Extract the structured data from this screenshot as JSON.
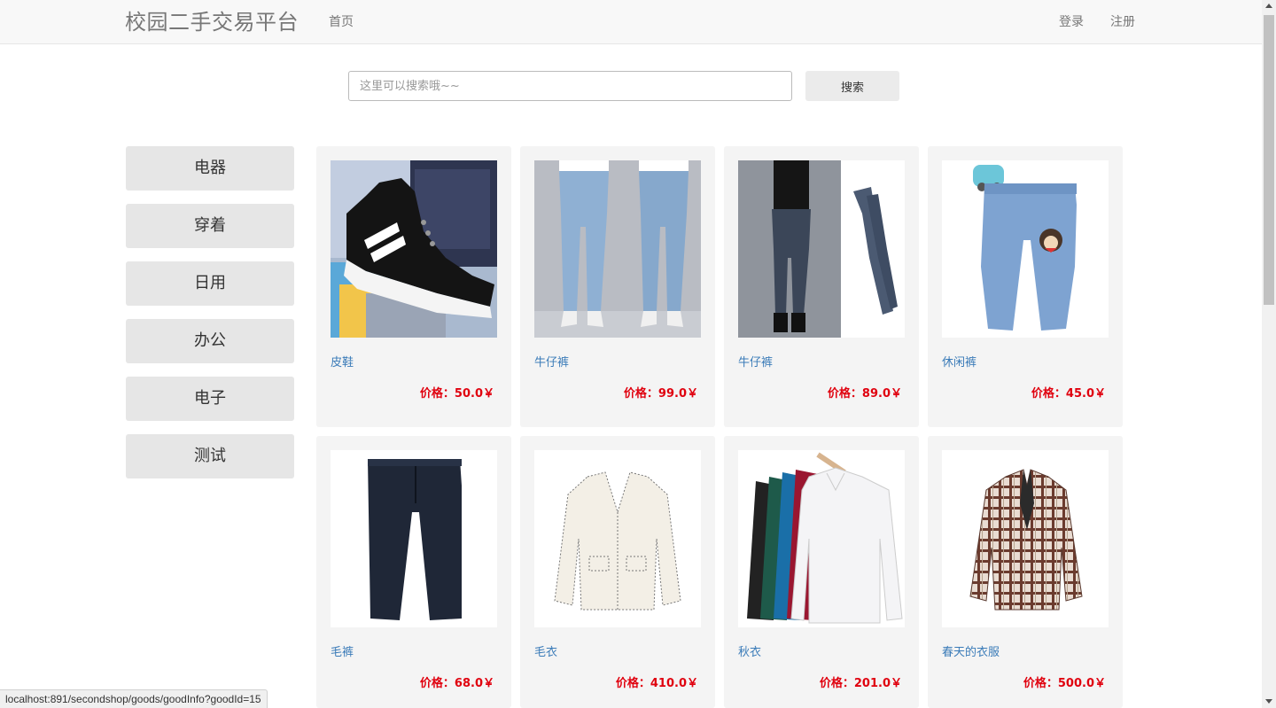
{
  "header": {
    "brand": "校园二手交易平台",
    "nav_home": "首页",
    "login": "登录",
    "register": "注册"
  },
  "search": {
    "placeholder": "这里可以搜索哦~~",
    "value": "",
    "button_label": "搜索"
  },
  "categories": [
    "电器",
    "穿着",
    "日用",
    "办公",
    "电子",
    "测试"
  ],
  "products": [
    {
      "name": "皮鞋",
      "price": "价格：50.0￥",
      "image": "sneaker-image"
    },
    {
      "name": "牛仔裤",
      "price": "价格：99.0￥",
      "image": "jeans-model-image"
    },
    {
      "name": "牛仔裤",
      "price": "价格：89.0￥",
      "image": "jeans-dark-image"
    },
    {
      "name": "休闲裤",
      "price": "价格：45.0￥",
      "image": "kids-pants-image"
    },
    {
      "name": "毛裤",
      "price": "价格：68.0￥",
      "image": "navy-trousers-image"
    },
    {
      "name": "毛衣",
      "price": "价格：410.0￥",
      "image": "cardigan-image"
    },
    {
      "name": "秋衣",
      "price": "价格：201.0￥",
      "image": "longsleeve-tops-image"
    },
    {
      "name": "春天的衣服",
      "price": "价格：500.0￥",
      "image": "plaid-blazer-image"
    }
  ],
  "status_bar": {
    "url": "localhost:891/secondshop/goods/goodInfo?goodId=15"
  },
  "colors": {
    "price": "#e0000e",
    "product_link": "#3a7bb8",
    "navbar_bg": "#f8f8f8",
    "card_bg": "#f4f4f4",
    "category_bg": "#e6e6e6"
  }
}
